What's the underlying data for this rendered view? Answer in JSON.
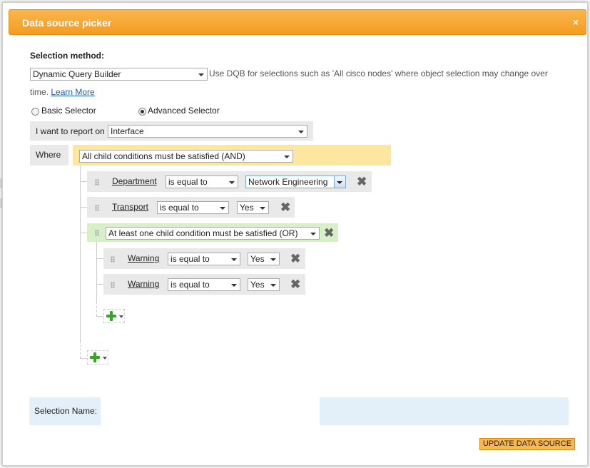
{
  "dialog": {
    "title": "Data source picker",
    "close_glyph": "×"
  },
  "selection_method": {
    "label": "Selection method:",
    "value": "Dynamic Query Builder",
    "help_line1": "Use DQB for selections such as 'All cisco nodes' where object selection may change over",
    "help_line2": "time.",
    "learn_more": "Learn More"
  },
  "selector": {
    "basic_label": "Basic Selector",
    "advanced_label": "Advanced Selector",
    "selected": "advanced"
  },
  "report": {
    "label": "I want to report on",
    "value": "Interface"
  },
  "where": {
    "label": "Where",
    "group_value": "All child conditions must be satisfied (AND)"
  },
  "conditions": {
    "department": {
      "field": "Department",
      "operator": "is equal to",
      "value": "Network Engineering"
    },
    "transport": {
      "field": "Transport",
      "operator": "is equal to",
      "value": "Yes"
    },
    "or_group": {
      "value": "At least one child condition must be satisfied (OR)",
      "warning1": {
        "field": "Warning",
        "operator": "is equal to",
        "value": "Yes"
      },
      "warning2": {
        "field": "Warning",
        "operator": "is equal to",
        "value": "Yes"
      }
    }
  },
  "selection_name": {
    "label": "Selection Name:",
    "value": ""
  },
  "update_button": "UPDATE DATA SOURCE",
  "icons": {
    "remove": "remove-x-icon",
    "add": "green-plus-icon",
    "drag": "drag-grip-icon"
  },
  "colors": {
    "title_bar": "#f39c21",
    "where_group": "#fde7a0",
    "or_group": "#d7f0c7",
    "name_bar": "#e4f0f9",
    "update_button": "#fbb64c"
  }
}
